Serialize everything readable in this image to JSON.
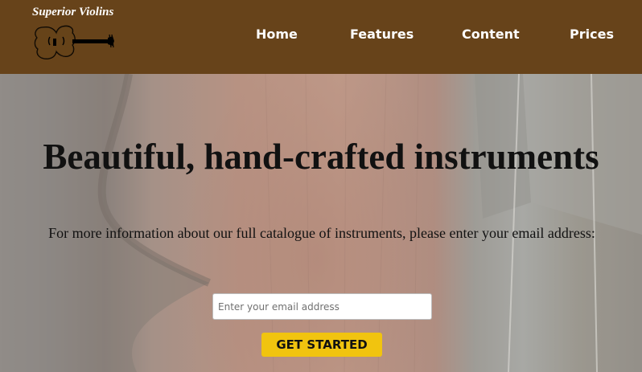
{
  "brand": {
    "name": "Superior Violins",
    "logo_icon": "violin-icon"
  },
  "nav": {
    "items": [
      {
        "label": "Home"
      },
      {
        "label": "Features"
      },
      {
        "label": "Content"
      },
      {
        "label": "Prices"
      }
    ]
  },
  "hero": {
    "title": "Beautiful, hand-crafted instruments",
    "description": "For more information about our full catalogue of instruments, please enter your email address:",
    "email_placeholder": "Enter your email address",
    "email_value": "",
    "cta_label": "GET STARTED"
  },
  "colors": {
    "header_bg": "#67431a",
    "cta_bg": "#f1c40f",
    "nav_text": "#ffffff"
  }
}
